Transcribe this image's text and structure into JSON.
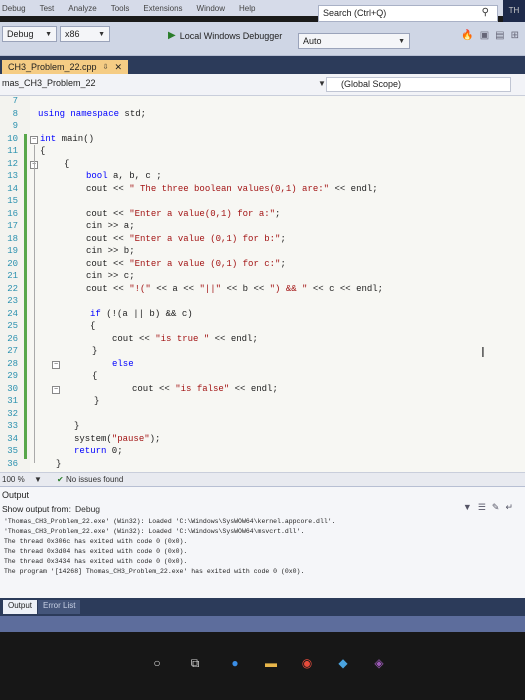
{
  "menu": {
    "items": [
      "Debug",
      "Test",
      "Analyze",
      "Tools",
      "Extensions",
      "Window",
      "Help"
    ],
    "search_placeholder": "Search (Ctrl+Q)",
    "corner_text": "TH"
  },
  "toolbar": {
    "config": "Debug",
    "platform": "x86",
    "run_label": "Local Windows Debugger",
    "run_mode": "Auto"
  },
  "tabs": {
    "file_tab": "CH3_Problem_22.cpp",
    "pin_glyph": "⇩",
    "close_glyph": "✕"
  },
  "nav": {
    "project": "mas_CH3_Problem_22",
    "scope": "(Global Scope)"
  },
  "editor": {
    "line_numbers": [
      "7",
      "8",
      "9",
      "10",
      "11",
      "12",
      "13",
      "14",
      "15",
      "16",
      "17",
      "18",
      "19",
      "20",
      "21",
      "22",
      "23",
      "24",
      "25",
      "26",
      "27",
      "28",
      "29",
      "30",
      "31",
      "32",
      "33",
      "34",
      "35",
      "36"
    ],
    "lines": {
      "l8_kw": "using namespace",
      "l8_rest": " std;",
      "l10_kw": "int",
      "l10_rest": " main()",
      "l11": "{",
      "l12": "{",
      "l13_kw": "bool",
      "l13_rest": " a, b, c ;",
      "l14_a": "cout << ",
      "l14_str": "\" The three boolean values(0,1) are:\"",
      "l14_b": " << endl;",
      "l16_a": "cout << ",
      "l16_str": "\"Enter a value(0,1) for a:\"",
      "l16_b": ";",
      "l17": "cin >> a;",
      "l18_a": "cout << ",
      "l18_str": "\"Enter a value (0,1) for b:\"",
      "l18_b": ";",
      "l19": "cin >> b;",
      "l20_a": "cout << ",
      "l20_str": "\"Enter a value (0,1) for c:\"",
      "l20_b": ";",
      "l21": "cin >> c;",
      "l22_a": "cout << ",
      "l22_s1": "\"!(\"",
      "l22_b": " << a << ",
      "l22_s2": "\"||\"",
      "l22_c": " << b << ",
      "l22_s3": "\") && \"",
      "l22_d": " << c << endl;",
      "l24_kw": "if",
      "l24_rest": " (!(a || b) && c)",
      "l25": "{",
      "l26_a": "cout << ",
      "l26_str": "\"is true \"",
      "l26_b": " << endl;",
      "l27": "}",
      "l28_kw": "else",
      "l29": "{",
      "l30_a": "cout << ",
      "l30_str": "\"is false\"",
      "l30_b": " << endl;",
      "l31": "}",
      "l33": "}",
      "l34_a": "system(",
      "l34_str": "\"pause\"",
      "l34_b": ");",
      "l35_kw": "return",
      "l35_rest": " 0;",
      "l36": "}"
    }
  },
  "status": {
    "zoom": "100 %",
    "issues_glyph": "✔",
    "issues": "No issues found"
  },
  "output": {
    "title": "Output",
    "show_from_label": "Show output from:",
    "show_from_value": "Debug",
    "lines": [
      "'Thomas_CH3_Problem_22.exe' (Win32): Loaded 'C:\\Windows\\SysWOW64\\kernel.appcore.dll'.",
      "'Thomas_CH3_Problem_22.exe' (Win32): Loaded 'C:\\Windows\\SysWOW64\\msvcrt.dll'.",
      "The thread 0x306c has exited with code 0 (0x0).",
      "The thread 0x3d04 has exited with code 0 (0x0).",
      "The thread 0x3434 has exited with code 0 (0x0).",
      "The program '[14268] Thomas_CH3_Problem_22.exe' has exited with code 0 (0x0)."
    ]
  },
  "bottom_tabs": {
    "active": "Output",
    "inactive": "Error List"
  }
}
